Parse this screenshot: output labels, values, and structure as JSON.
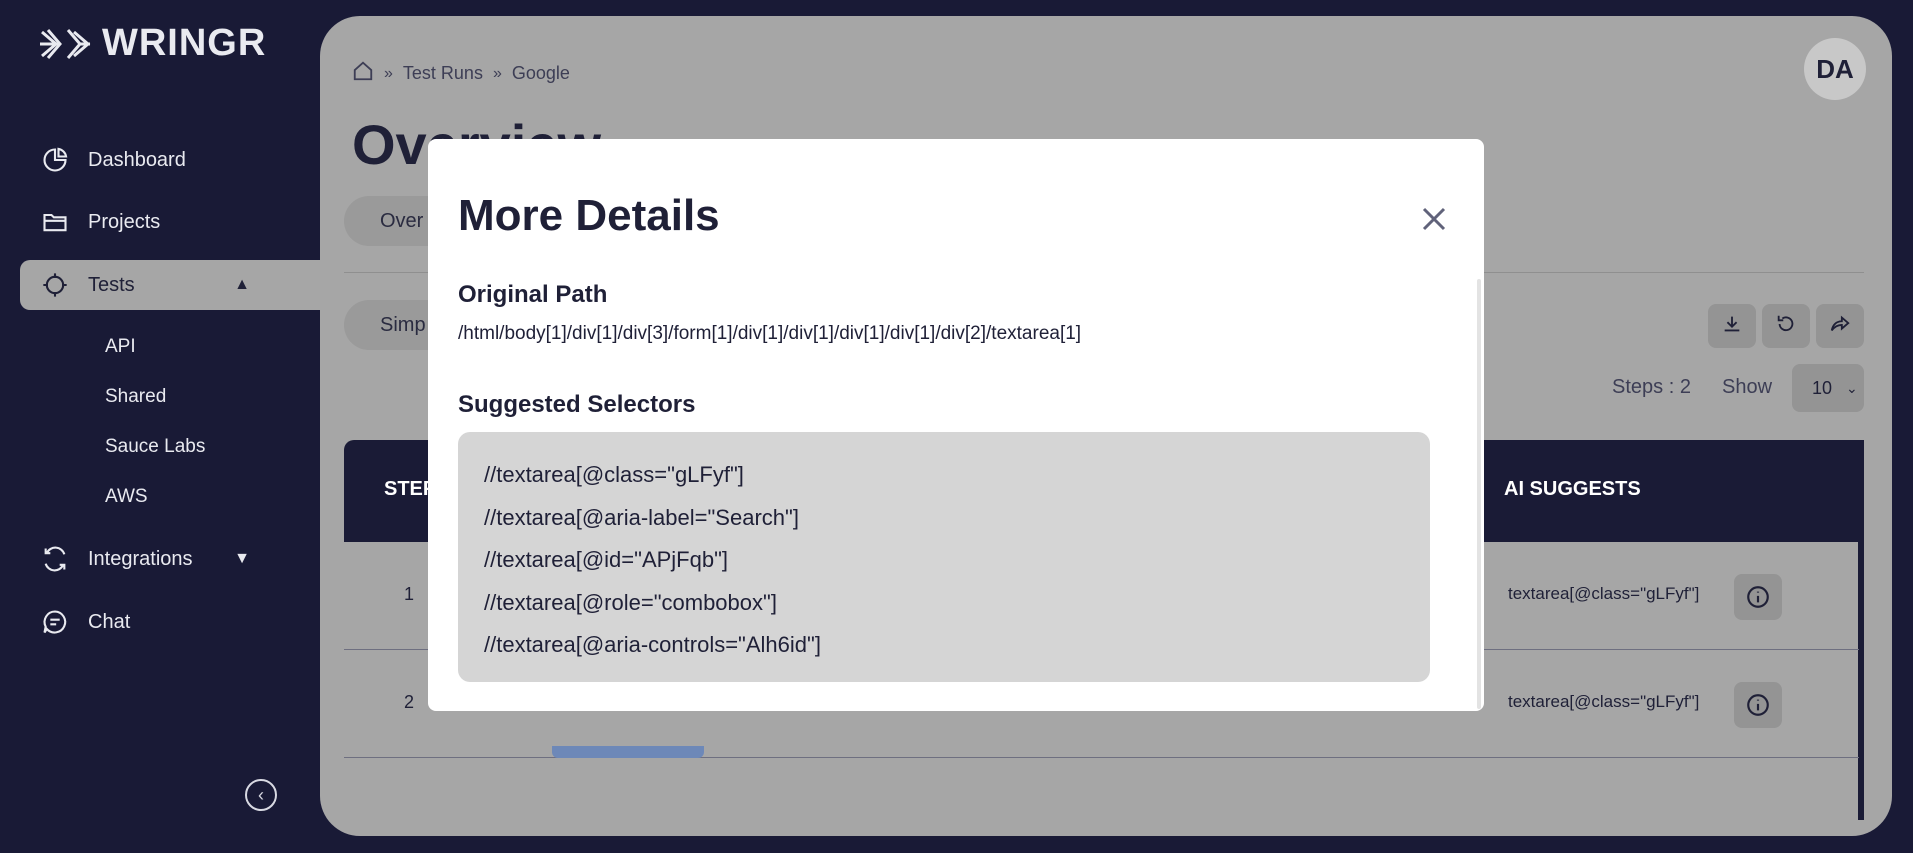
{
  "app": {
    "logo_text": "WRINGR"
  },
  "sidebar": {
    "items": [
      {
        "label": "Dashboard",
        "icon": "pie-chart-icon"
      },
      {
        "label": "Projects",
        "icon": "folder-icon"
      },
      {
        "label": "Tests",
        "icon": "crosshair-icon",
        "active": true
      },
      {
        "label": "Integrations",
        "icon": "refresh-icon"
      },
      {
        "label": "Chat",
        "icon": "chat-icon"
      }
    ],
    "sub_items": [
      "API",
      "Shared",
      "Sauce Labs",
      "AWS"
    ]
  },
  "header": {
    "breadcrumb": [
      "Test Runs",
      "Google"
    ],
    "avatar_initials": "DA",
    "title": "Overview"
  },
  "toolbar": {
    "tab_label": "Over",
    "simple_label": "Simp",
    "steps_label": "Steps : 2",
    "show_label": "Show",
    "show_value": "10"
  },
  "table": {
    "headers": {
      "step": "STEP",
      "ai": "AI SUGGESTS"
    },
    "rows": [
      {
        "num": "1",
        "ai": "textarea[@class=\"gLFyf\"]"
      },
      {
        "num": "2",
        "ai": "textarea[@class=\"gLFyf\"]"
      }
    ]
  },
  "modal": {
    "title": "More Details",
    "original_path_label": "Original Path",
    "original_path": "/html/body[1]/div[1]/div[3]/form[1]/div[1]/div[1]/div[1]/div[1]/div[2]/textarea[1]",
    "suggested_label": "Suggested Selectors",
    "selectors": [
      "//textarea[@class=\"gLFyf\"]",
      "//textarea[@aria-label=\"Search\"]",
      "//textarea[@id=\"APjFqb\"]",
      "//textarea[@role=\"combobox\"]",
      "//textarea[@aria-controls=\"Alh6id\"]"
    ]
  },
  "colors": {
    "sidebar_bg": "#191a36",
    "overlay_panel": "#a6a6a6",
    "modal_bg": "#ffffff"
  }
}
